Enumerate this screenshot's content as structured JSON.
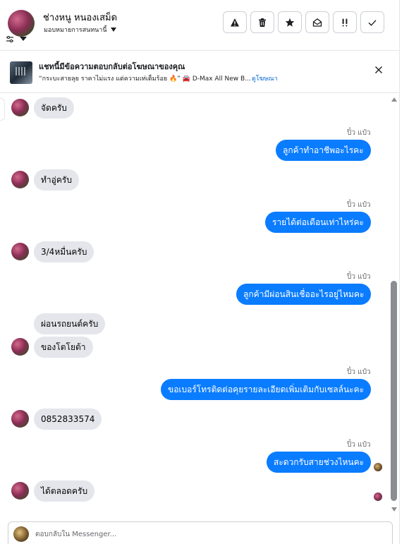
{
  "header": {
    "contact_name": "ช่างหนู หนองเสม็ด",
    "assign_label": "มอบหมายการสนทนานี้",
    "actions": [
      {
        "name": "report-spam-button",
        "icon": "warning-icon"
      },
      {
        "name": "delete-button",
        "icon": "trash-icon"
      },
      {
        "name": "star-button",
        "icon": "star-icon"
      },
      {
        "name": "mark-unread-button",
        "icon": "envelope-open-icon"
      },
      {
        "name": "follow-up-button",
        "icon": "double-exclamation-icon"
      },
      {
        "name": "mark-done-button",
        "icon": "check-icon"
      }
    ]
  },
  "ad_banner": {
    "title": "แชทนี้มีข้อความตอบกลับต่อโฆษณาของคุณ",
    "subtitle": "“กระบะสายลุย ราคาไม่แรง แต่ความเท่เต็มร้อย 🔥” 🚘 D-Max All New B...",
    "link": "ดูโฆษณา"
  },
  "messages": [
    {
      "dir": "in",
      "text": "จัดครับ"
    },
    {
      "dir": "out",
      "sender": "ปิ๋ว แป๋ว",
      "text": "ลูกค้าทำอาชีพอะไรคะ"
    },
    {
      "dir": "in",
      "text": "ทำอู่ครับ"
    },
    {
      "dir": "out",
      "sender": "ปิ๋ว แป๋ว",
      "text": "รายได้ต่อเดือนเท่าไหร่คะ"
    },
    {
      "dir": "in",
      "text": "3/4หมื่นครับ"
    },
    {
      "dir": "out",
      "sender": "ปิ๋ว แป๋ว",
      "text": "ลูกค้ามีผ่อนสินเชื่ออะไรอยู่ไหมคะ"
    },
    {
      "dir": "in",
      "text": "ผ่อนรถยนต์ครับ"
    },
    {
      "dir": "in",
      "text": "ของโตโยต้า"
    },
    {
      "dir": "out",
      "sender": "ปิ๋ว แป๋ว",
      "text": "ขอเบอร์โทรติดต่อคุยรายละเอียดเพิ่มเติมกับเซลล์นะคะ"
    },
    {
      "dir": "in",
      "text": "0852833574"
    },
    {
      "dir": "out",
      "sender": "ปิ๋ว แป๋ว",
      "text": "สะดวกรับสายช่วงไหนคะ"
    },
    {
      "dir": "in",
      "text": "ได้ตลอดครับ"
    }
  ],
  "composer": {
    "placeholder": "ตอบกลับใน Messenger..."
  },
  "colors": {
    "outgoing_bubble": "#0a7cff",
    "incoming_bubble": "#e4e6eb",
    "link": "#0064d1"
  }
}
